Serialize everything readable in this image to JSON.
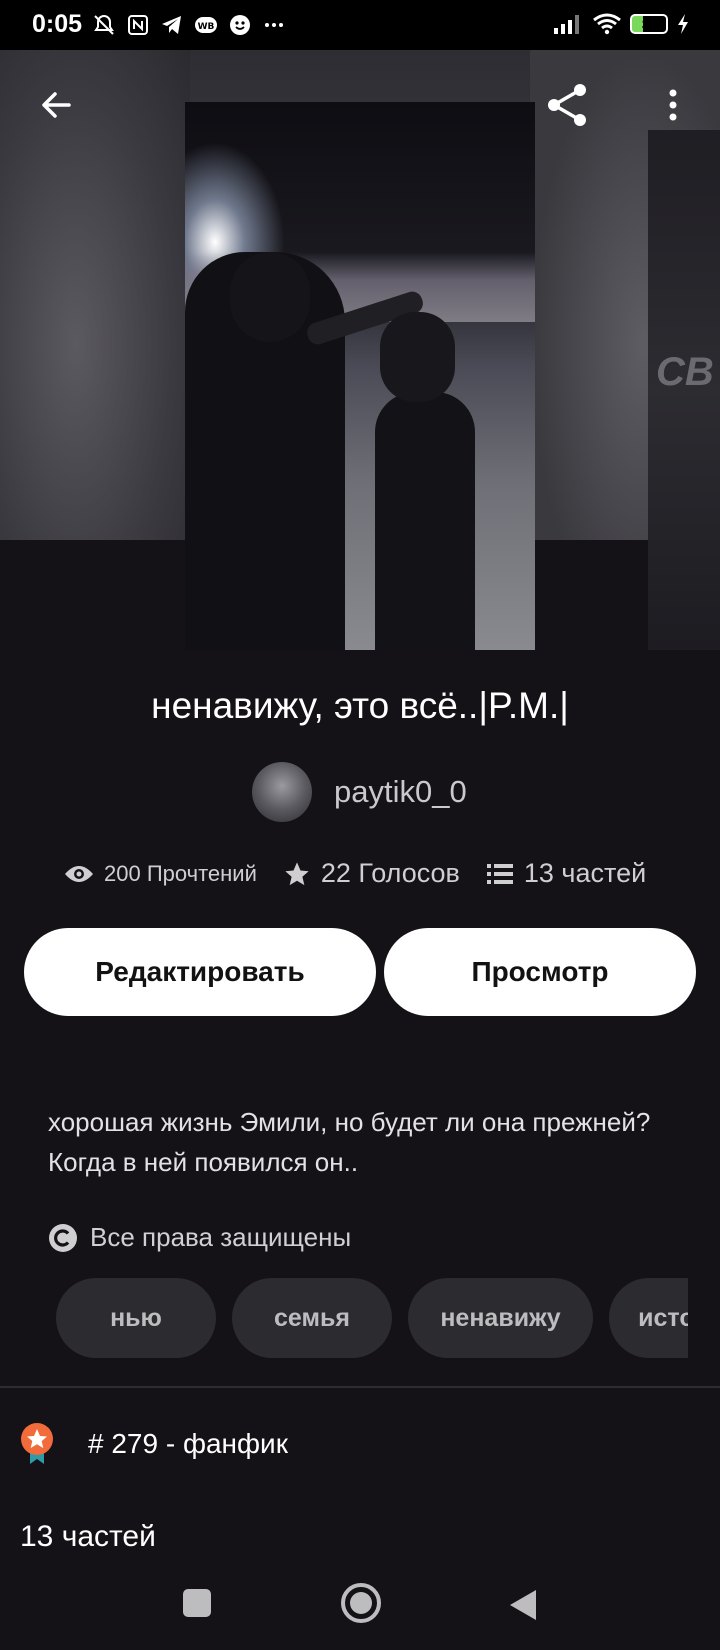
{
  "status_bar": {
    "time": "0:05",
    "battery": "31"
  },
  "header": {
    "back_icon": "arrow-left-icon",
    "share_icon": "share-icon",
    "more_icon": "more-vertical-icon"
  },
  "story": {
    "title": "ненавижу, это всё..|P.M.|",
    "author": "paytik0_0",
    "reads": "200 Прочтений",
    "votes": "22 Голосов",
    "parts": "13 частей",
    "description": "хорошая жизнь Эмили, но будет ли она прежней? Когда в ней появился он..",
    "rights": "Все права защищены",
    "tags": [
      "нью",
      "семья",
      "ненавижу",
      "история"
    ],
    "rank": "# 279 - фанфик",
    "parts_heading": "13 частей"
  },
  "buttons": {
    "edit": "Редактировать",
    "view": "Просмотр"
  },
  "colors": {
    "background": "#141217",
    "button_bg": "#ffffff",
    "tag_bg": "#2c2b30",
    "rank_badge": "#f26b3a"
  }
}
